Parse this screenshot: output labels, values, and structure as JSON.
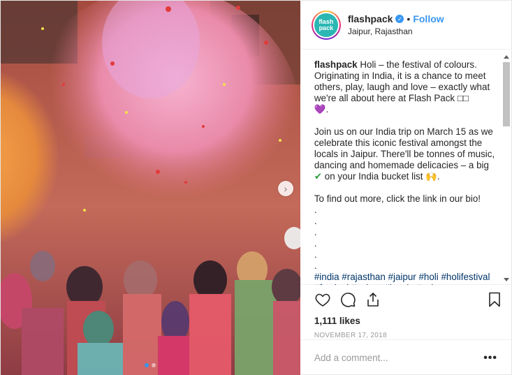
{
  "user": {
    "username": "flashpack",
    "avatar_text": "flash pack",
    "verified_icon": "verified-check-icon",
    "separator": "•",
    "follow_label": "Follow",
    "location": "Jaipur, Rajasthan"
  },
  "caption": {
    "username": "flashpack",
    "paragraph1": "Holi – the festival of colours. Originating in India, it is a chance to meet others, play, laugh and love – exactly what we're all about here at Flash Pack □□",
    "paragraph1_end": "💜.",
    "paragraph2": "Join us on our India trip on March 15 as we celebrate this iconic festival amongst the locals in Jaipur. There'll be tonnes of music, dancing and homemade delicacies – a big",
    "paragraph2_check": "✔",
    "paragraph2_end": "on your India bucket list",
    "paragraph2_emoji": "🙌.",
    "paragraph3": "To find out more, click the link in our bio!",
    "dots": [
      ".",
      ".",
      ".",
      ".",
      ".",
      "."
    ],
    "hashtags": "#india #rajasthan #jaipur #holi #holifestival #festival #colour #locals #culture"
  },
  "actions": {
    "like_icon": "heart-icon",
    "comment_icon": "comment-bubble-icon",
    "share_icon": "share-upload-icon",
    "save_icon": "bookmark-icon"
  },
  "likes": "1,111 likes",
  "date": "NOVEMBER 17, 2018",
  "comment": {
    "placeholder": "Add a comment...",
    "more_label": "•••"
  },
  "media": {
    "next_label": "›",
    "carousel_count": 2,
    "active_index": 0
  },
  "colors": {
    "accent": "#3897f0",
    "hashtag": "#003569",
    "avatar_bg": "#2bb7b3"
  }
}
